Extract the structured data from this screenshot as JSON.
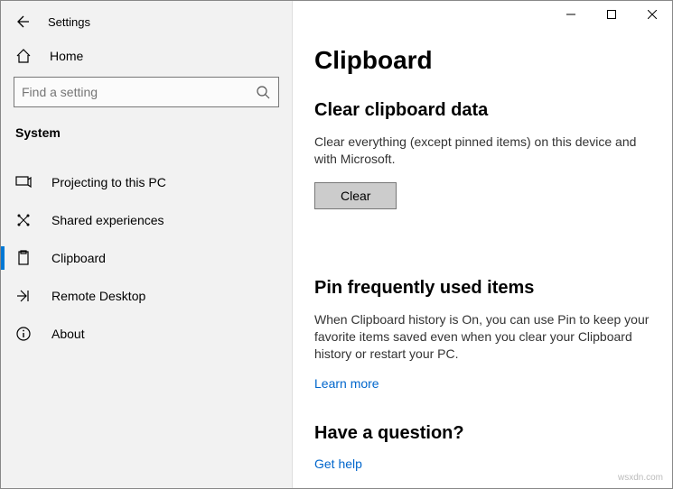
{
  "app_title": "Settings",
  "home_label": "Home",
  "search_placeholder": "Find a setting",
  "section_label": "System",
  "nav": {
    "projecting": "Projecting to this PC",
    "shared": "Shared experiences",
    "clipboard": "Clipboard",
    "remote": "Remote Desktop",
    "about": "About"
  },
  "page": {
    "title": "Clipboard",
    "clear_heading": "Clear clipboard data",
    "clear_desc": "Clear everything (except pinned items) on this device and with Microsoft.",
    "clear_button": "Clear",
    "pin_heading": "Pin frequently used items",
    "pin_desc": "When Clipboard history is On, you can use Pin to keep your favorite items saved even when you clear your Clipboard history or restart your PC.",
    "learn_more": "Learn more",
    "question_heading": "Have a question?",
    "get_help": "Get help"
  },
  "watermark": "wsxdn.com"
}
